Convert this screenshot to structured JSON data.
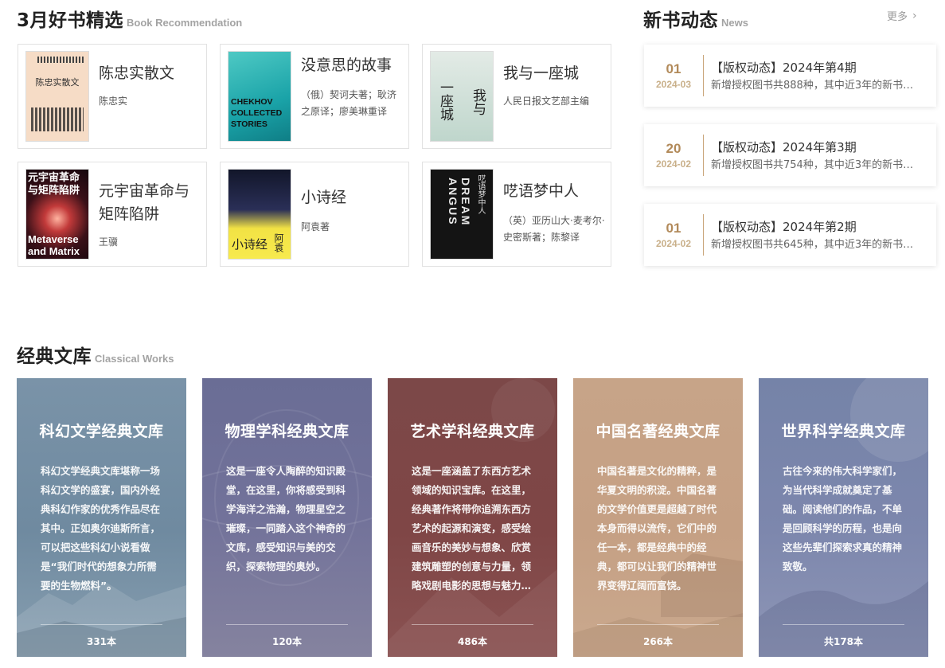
{
  "recommend": {
    "title": "3月好书精选",
    "subtitle": "Book Recommendation",
    "books": [
      {
        "title": "陈忠实散文",
        "author": "陈忠实",
        "cover_text": "陈忠实散文"
      },
      {
        "title": "没意思的故事",
        "author": "（俄）契诃夫著；耿济之原译；廖美琳重译",
        "cover_text": "CHEKHOV COLLECTED STORIES"
      },
      {
        "title": "我与一座城",
        "author": "人民日报文艺部主编",
        "cover_text_1": "一座城",
        "cover_text_2": "我与"
      },
      {
        "title": "元宇宙革命与矩阵陷阱",
        "author": "王骥",
        "cover_text_1": "元宇宙革命与矩阵陷阱",
        "cover_text_2": "Metaverse and Matrix"
      },
      {
        "title": "小诗经",
        "author": "阿袁著",
        "cover_text_1": "小诗经",
        "cover_text_2": "阿袁"
      },
      {
        "title": "呓语梦中人",
        "author": "（英）亚历山大·麦考尔·史密斯著；陈黎译",
        "cover_text_1": "DREAM ANGUS",
        "cover_text_2": "呓语梦中人"
      }
    ]
  },
  "news": {
    "title": "新书动态",
    "subtitle": "News",
    "more": "更多",
    "items": [
      {
        "day": "01",
        "month": "2024-03",
        "title": "【版权动态】2024年第4期",
        "desc": "新增授权图书共888种，其中近3年的新书…"
      },
      {
        "day": "20",
        "month": "2024-02",
        "title": "【版权动态】2024年第3期",
        "desc": "新增授权图书共754种，其中近3年的新书…"
      },
      {
        "day": "01",
        "month": "2024-02",
        "title": "【版权动态】2024年第2期",
        "desc": "新增授权图书共645种，其中近3年的新书…"
      }
    ]
  },
  "classics": {
    "title": "经典文库",
    "subtitle": "Classical Works",
    "items": [
      {
        "title": "科幻文学经典文库",
        "desc": "科幻文学经典文库堪称一场科幻文学的盛宴，国内外经典科幻作家的优秀作品尽在其中。正如奥尔迪斯所言，可以把这些科幻小说看做是“我们时代的想象力所需要的生物燃料”。",
        "count": "331本"
      },
      {
        "title": "物理学科经典文库",
        "desc": "这是一座令人陶醉的知识殿堂，在这里，你将感受到科学海洋之浩瀚，物理星空之璀璨，一同踏入这个神奇的文库，感受知识与美的交织，探索物理的奥妙。",
        "count": "120本"
      },
      {
        "title": "艺术学科经典文库",
        "desc": "这是一座涵盖了东西方艺术领域的知识宝库。在这里，经典著作将带你追溯东西方艺术的起源和演变，感受绘画音乐的美妙与想象、欣赏建筑雕塑的创意与力量，领略戏剧电影的思想与魅力…",
        "count": "486本"
      },
      {
        "title": "中国名著经典文库",
        "desc": "中国名著是文化的精粹，是华夏文明的积淀。中国名著的文学价值更是超越了时代本身而得以流传，它们中的任一本，都是经典中的经典，都可以让我们的精神世界变得辽阔而富饶。",
        "count": "266本"
      },
      {
        "title": "世界科学经典文库",
        "desc": "古往今来的伟大科学家们，为当代科学成就奠定了基础。阅读他们的作品，不单是回顾科学的历程，也是向这些先辈们探索求真的精神致敬。",
        "count": "共178本"
      }
    ]
  }
}
